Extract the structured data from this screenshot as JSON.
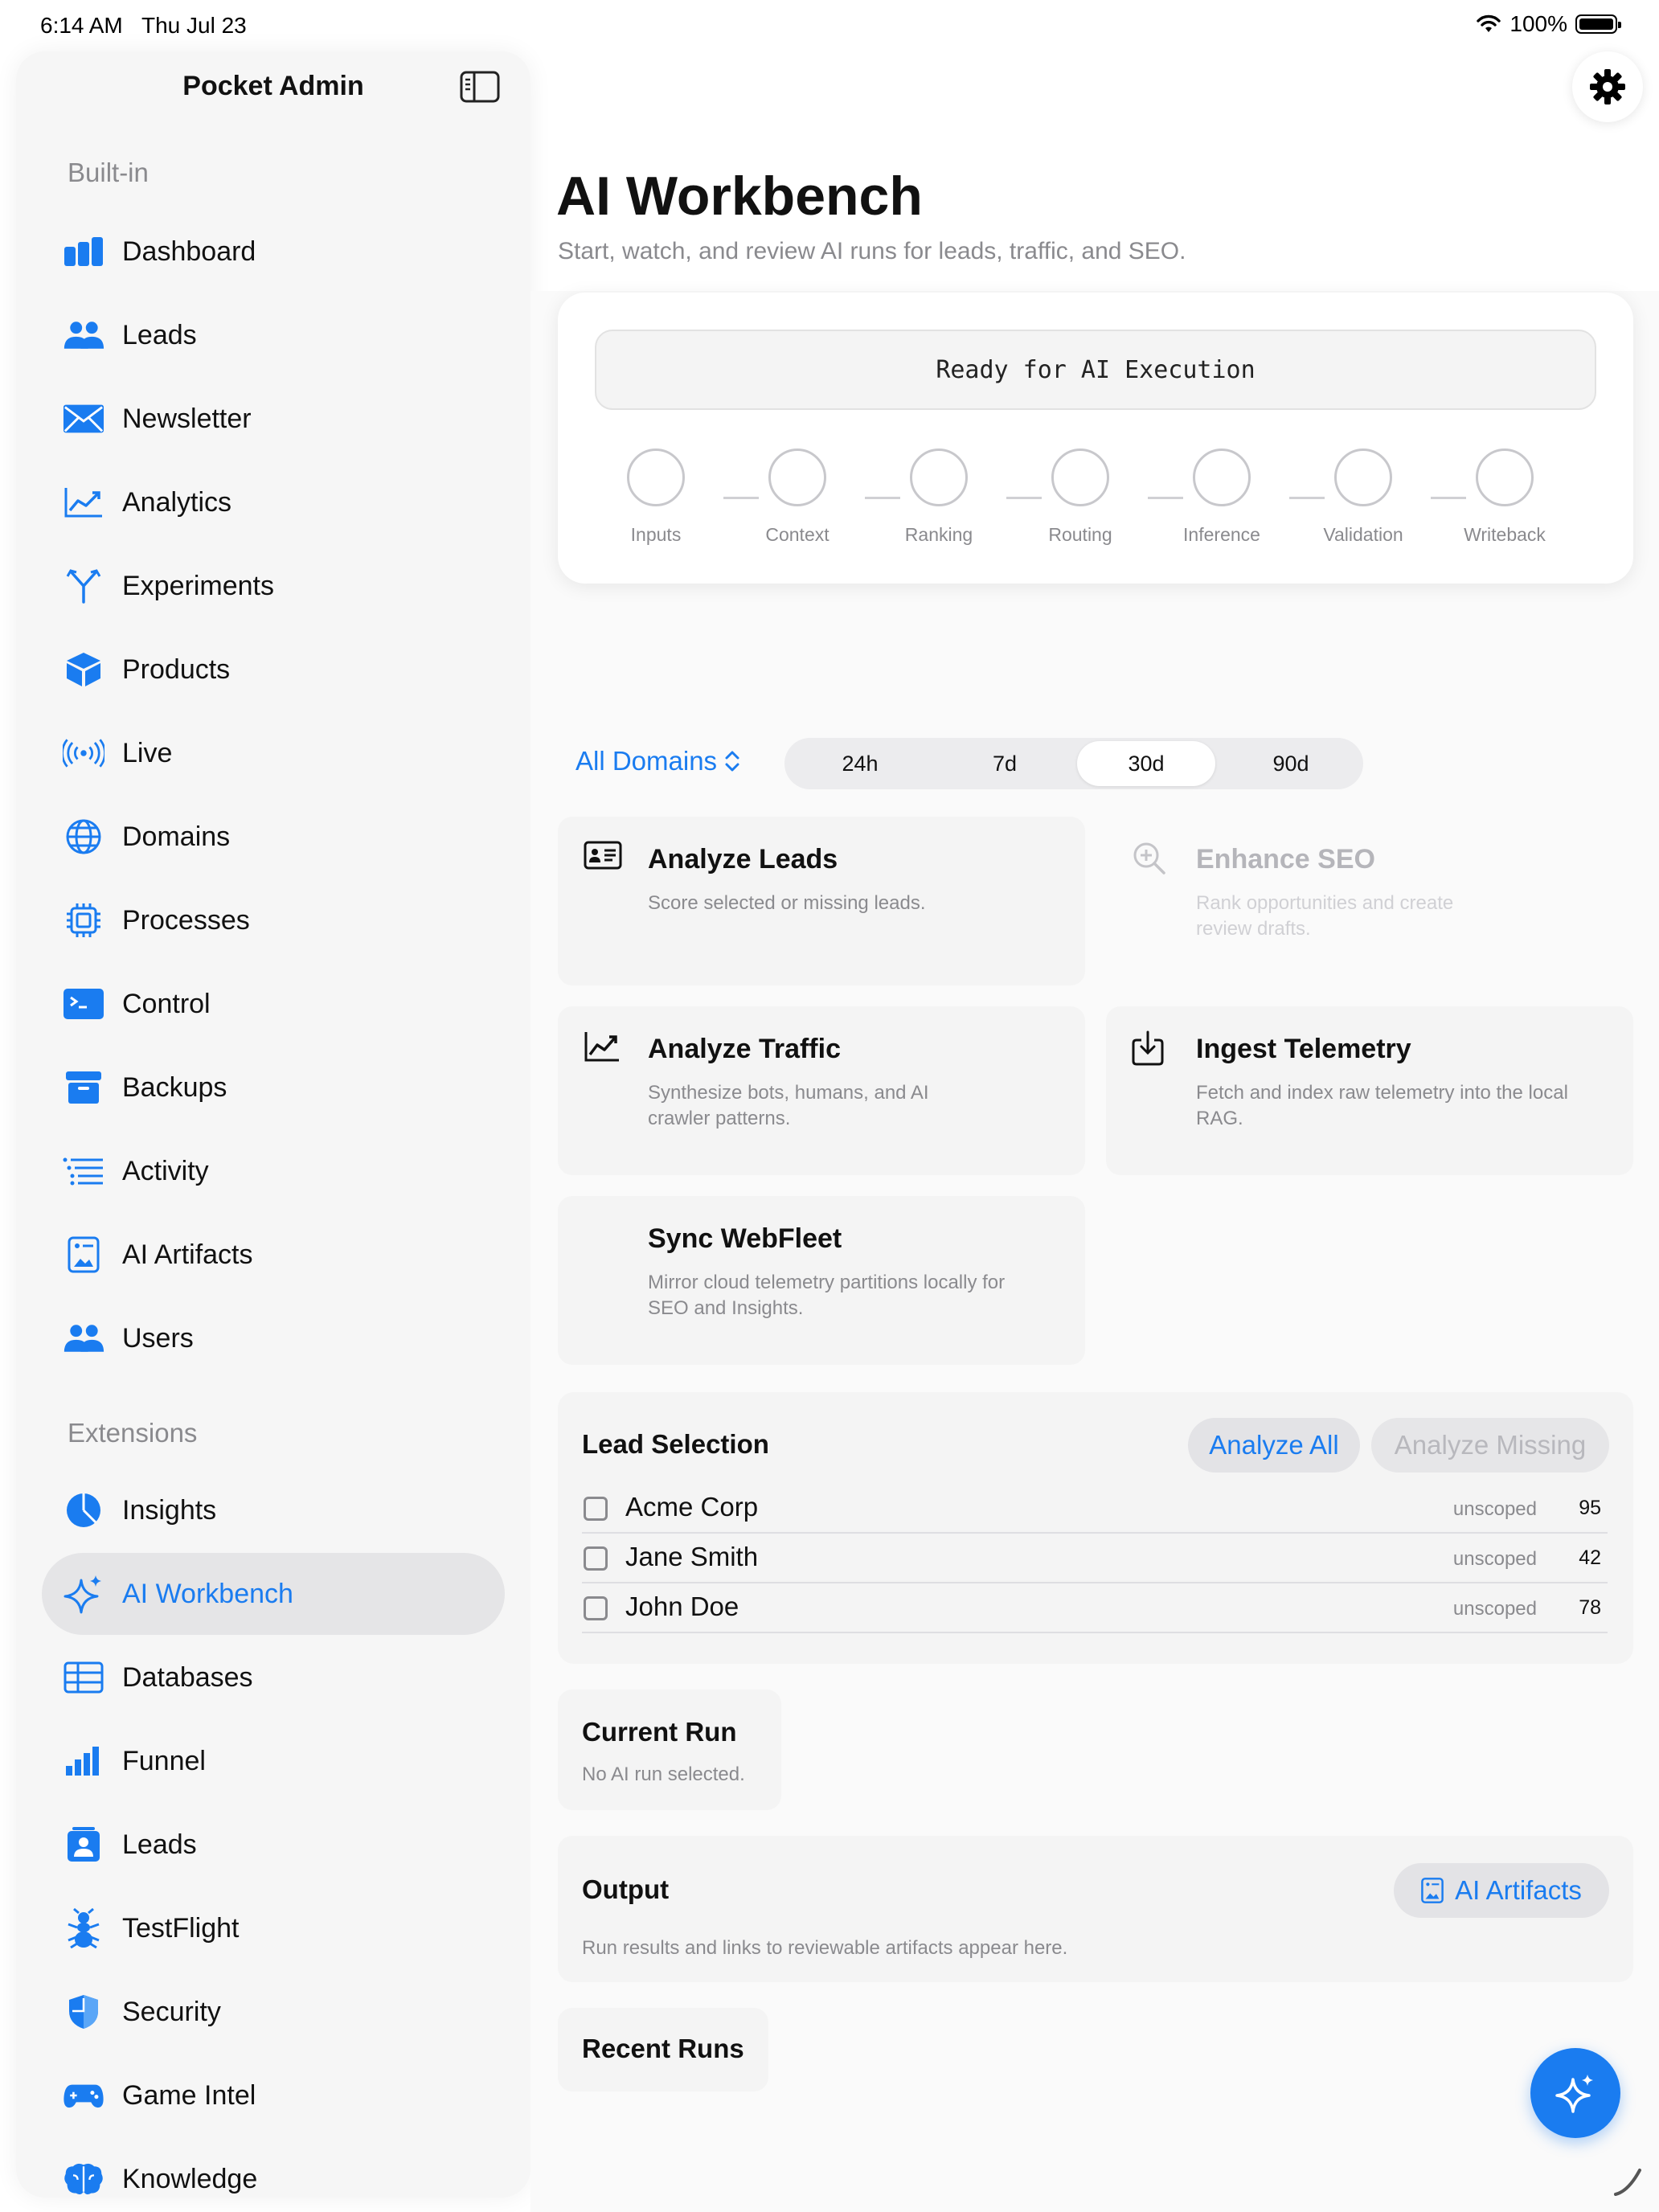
{
  "status_bar": {
    "time": "6:14 AM",
    "date": "Thu Jul 23",
    "battery": "100%"
  },
  "sidebar": {
    "title": "Pocket Admin",
    "sections": [
      {
        "label": "Built-in",
        "items": [
          {
            "label": "Dashboard",
            "icon": "dashboard-icon"
          },
          {
            "label": "Leads",
            "icon": "people-icon"
          },
          {
            "label": "Newsletter",
            "icon": "envelope-icon"
          },
          {
            "label": "Analytics",
            "icon": "chart-line-icon"
          },
          {
            "label": "Experiments",
            "icon": "branch-icon"
          },
          {
            "label": "Products",
            "icon": "box-icon"
          },
          {
            "label": "Live",
            "icon": "broadcast-icon"
          },
          {
            "label": "Domains",
            "icon": "globe-icon"
          },
          {
            "label": "Processes",
            "icon": "cpu-icon"
          },
          {
            "label": "Control",
            "icon": "terminal-icon"
          },
          {
            "label": "Backups",
            "icon": "archive-icon"
          },
          {
            "label": "Activity",
            "icon": "list-icon"
          },
          {
            "label": "AI Artifacts",
            "icon": "document-image-icon"
          },
          {
            "label": "Users",
            "icon": "people-icon"
          }
        ]
      },
      {
        "label": "Extensions",
        "items": [
          {
            "label": "Insights",
            "icon": "pie-chart-icon"
          },
          {
            "label": "AI Workbench",
            "icon": "sparkles-icon",
            "active": true
          },
          {
            "label": "Databases",
            "icon": "table-icon"
          },
          {
            "label": "Funnel",
            "icon": "bar-chart-icon"
          },
          {
            "label": "Leads",
            "icon": "person-card-icon"
          },
          {
            "label": "TestFlight",
            "icon": "ant-icon"
          },
          {
            "label": "Security",
            "icon": "shield-icon"
          },
          {
            "label": "Game Intel",
            "icon": "gamepad-icon"
          },
          {
            "label": "Knowledge",
            "icon": "brain-icon"
          }
        ]
      }
    ]
  },
  "main": {
    "title": "AI Workbench",
    "subtitle": "Start, watch, and review AI runs for leads, traffic, and SEO.",
    "execution": {
      "status": "Ready for AI Execution",
      "steps": [
        "Inputs",
        "Context",
        "Ranking",
        "Routing",
        "Inference",
        "Validation",
        "Writeback"
      ]
    },
    "filters": {
      "domain": "All Domains",
      "ranges": [
        "24h",
        "7d",
        "30d",
        "90d"
      ],
      "selected_range": "30d"
    },
    "actions": [
      {
        "title": "Analyze Leads",
        "desc": "Score selected or missing leads.",
        "icon": "id-card-icon",
        "enabled": true
      },
      {
        "title": "Enhance SEO",
        "desc": "Rank opportunities and create review drafts.",
        "icon": "magnify-plus-icon",
        "enabled": false
      },
      {
        "title": "Analyze Traffic",
        "desc": "Synthesize bots, humans, and AI crawler patterns.",
        "icon": "trend-icon",
        "enabled": true
      },
      {
        "title": "Ingest Telemetry",
        "desc": "Fetch and index raw telemetry into the local RAG.",
        "icon": "download-tray-icon",
        "enabled": true
      },
      {
        "title": "Sync WebFleet",
        "desc": "Mirror cloud telemetry partitions locally for SEO and Insights.",
        "icon": "",
        "enabled": true
      }
    ],
    "lead_selection": {
      "title": "Lead Selection",
      "analyze_all": "Analyze All",
      "analyze_missing": "Analyze Missing",
      "leads": [
        {
          "name": "Acme Corp",
          "scope": "unscoped",
          "score": "95"
        },
        {
          "name": "Jane Smith",
          "scope": "unscoped",
          "score": "42"
        },
        {
          "name": "John Doe",
          "scope": "unscoped",
          "score": "78"
        }
      ]
    },
    "current_run": {
      "title": "Current Run",
      "empty": "No AI run selected."
    },
    "output": {
      "title": "Output",
      "button": "AI Artifacts",
      "desc": "Run results and links to reviewable artifacts appear here."
    },
    "recent_runs": {
      "title": "Recent Runs"
    }
  },
  "colors": {
    "accent": "#1a7cf0",
    "secondary_text": "#8a8a8e",
    "card_bg": "#f4f4f4"
  }
}
